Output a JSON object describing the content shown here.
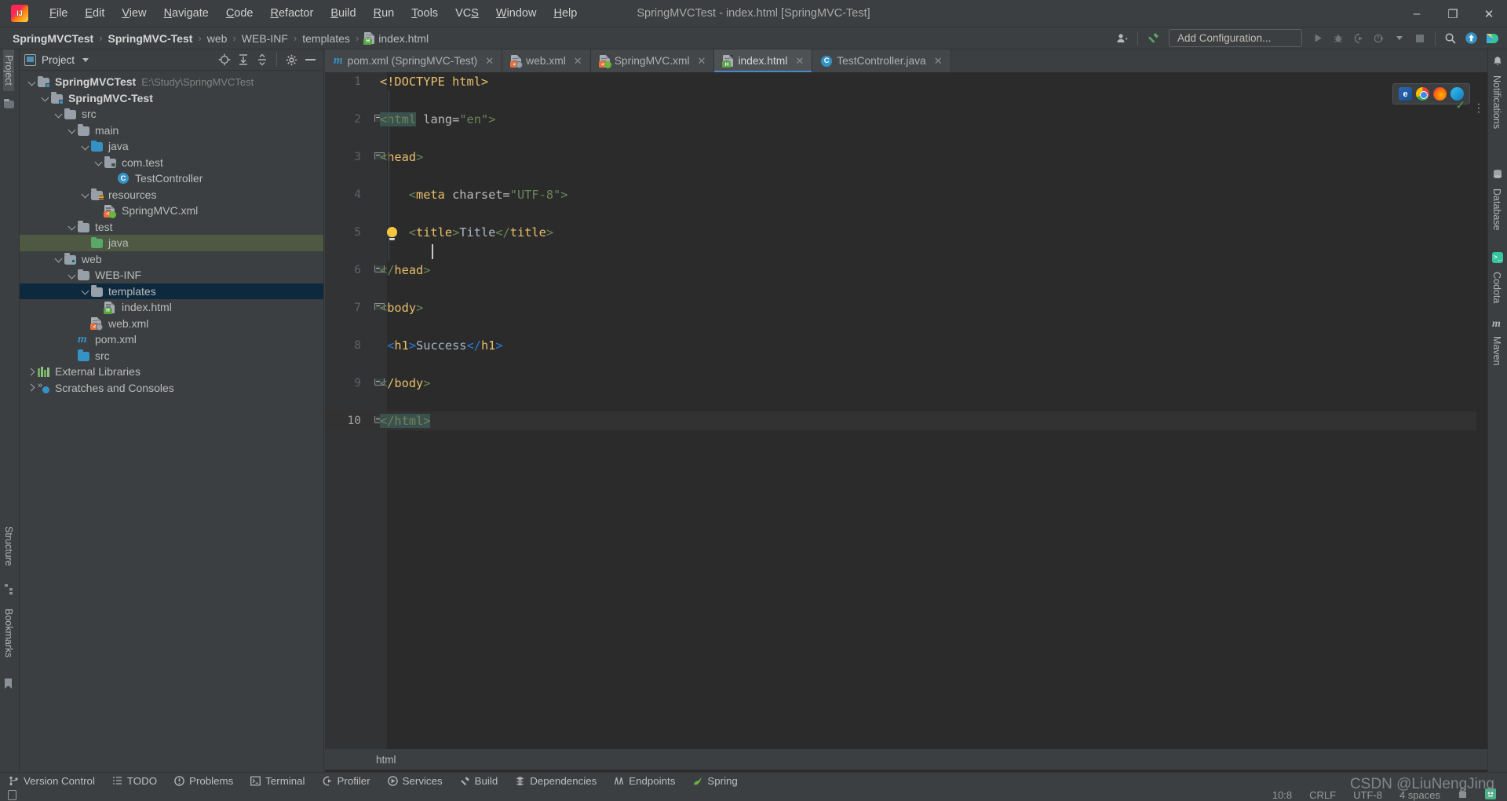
{
  "titlebar": {
    "logo": "intellij-idea-logo",
    "menus": [
      "File",
      "Edit",
      "View",
      "Navigate",
      "Code",
      "Refactor",
      "Build",
      "Run",
      "Tools",
      "VCS",
      "Window",
      "Help"
    ],
    "window_title": "SpringMVCTest - index.html [SpringMVC-Test]",
    "minimize": "–",
    "maximize": "❐",
    "close": "✕"
  },
  "navbar": {
    "breadcrumbs": [
      {
        "label": "SpringMVCTest",
        "bold": true
      },
      {
        "label": "SpringMVC-Test",
        "bold": true
      },
      {
        "label": "web",
        "bold": false
      },
      {
        "label": "WEB-INF",
        "bold": false
      },
      {
        "label": "templates",
        "bold": false
      },
      {
        "label": "index.html",
        "bold": false,
        "icon": "html-file-icon"
      }
    ],
    "separator": "›",
    "add_configuration": "Add Configuration...",
    "icons": [
      "user-avatar-icon",
      "hammer-build-icon",
      "run-icon",
      "debug-icon",
      "run-coverage-icon",
      "profile-icon",
      "stop-icon",
      "search-everywhere-icon",
      "update-project-icon",
      "codota-icon"
    ]
  },
  "left_strip": {
    "tabs": [
      "Project",
      "Structure",
      "Bookmarks"
    ]
  },
  "right_strip": {
    "tabs": [
      "Notifications",
      "Database",
      "Codota",
      "Maven"
    ]
  },
  "project_panel": {
    "title": "Project",
    "header_icons": [
      "locate-icon",
      "expand-all-icon",
      "collapse-all-icon",
      "settings-gear-icon",
      "hide-icon"
    ],
    "tree": [
      {
        "depth": 0,
        "label": "SpringMVCTest",
        "path": "E:\\Study\\SpringMVCTest",
        "arrow": "down",
        "icon": "project-folder-icon",
        "bold": true,
        "state": "none"
      },
      {
        "depth": 1,
        "label": "SpringMVC-Test",
        "path": "",
        "arrow": "down",
        "icon": "module-folder-icon",
        "bold": true,
        "state": "none"
      },
      {
        "depth": 2,
        "label": "src",
        "path": "",
        "arrow": "down",
        "icon": "folder-icon",
        "bold": false,
        "state": "none"
      },
      {
        "depth": 3,
        "label": "main",
        "path": "",
        "arrow": "down",
        "icon": "folder-icon",
        "bold": false,
        "state": "none"
      },
      {
        "depth": 4,
        "label": "java",
        "path": "",
        "arrow": "down",
        "icon": "source-folder-icon",
        "bold": false,
        "state": "none"
      },
      {
        "depth": 5,
        "label": "com.test",
        "path": "",
        "arrow": "down",
        "icon": "package-folder-icon",
        "bold": false,
        "state": "none"
      },
      {
        "depth": 6,
        "label": "TestController",
        "path": "",
        "arrow": "none",
        "icon": "java-class-icon",
        "bold": false,
        "state": "none"
      },
      {
        "depth": 4,
        "label": "resources",
        "path": "",
        "arrow": "down",
        "icon": "resources-folder-icon",
        "bold": false,
        "state": "none"
      },
      {
        "depth": 5,
        "label": "SpringMVC.xml",
        "path": "",
        "arrow": "none",
        "icon": "spring-xml-file-icon",
        "bold": false,
        "state": "none"
      },
      {
        "depth": 3,
        "label": "test",
        "path": "",
        "arrow": "down",
        "icon": "folder-icon",
        "bold": false,
        "state": "none"
      },
      {
        "depth": 4,
        "label": "java",
        "path": "",
        "arrow": "none",
        "icon": "test-source-folder-icon",
        "bold": false,
        "state": "selected-green"
      },
      {
        "depth": 2,
        "label": "web",
        "path": "",
        "arrow": "down",
        "icon": "web-folder-icon",
        "bold": false,
        "state": "none"
      },
      {
        "depth": 3,
        "label": "WEB-INF",
        "path": "",
        "arrow": "down",
        "icon": "folder-icon",
        "bold": false,
        "state": "none"
      },
      {
        "depth": 4,
        "label": "templates",
        "path": "",
        "arrow": "down",
        "icon": "folder-icon",
        "bold": false,
        "state": "selected-blue"
      },
      {
        "depth": 5,
        "label": "index.html",
        "path": "",
        "arrow": "none",
        "icon": "html-file-icon",
        "bold": false,
        "state": "none"
      },
      {
        "depth": 4,
        "label": "web.xml",
        "path": "",
        "arrow": "none",
        "icon": "web-xml-file-icon",
        "bold": false,
        "state": "none"
      },
      {
        "depth": 3,
        "label": "pom.xml",
        "path": "",
        "arrow": "none",
        "icon": "maven-pom-icon",
        "bold": false,
        "state": "none"
      },
      {
        "depth": 3,
        "label": "src",
        "path": "",
        "arrow": "none",
        "icon": "source-folder-icon",
        "bold": false,
        "state": "none"
      },
      {
        "depth": 0,
        "label": "External Libraries",
        "path": "",
        "arrow": "right",
        "icon": "libraries-icon",
        "bold": false,
        "state": "none"
      },
      {
        "depth": 0,
        "label": "Scratches and Consoles",
        "path": "",
        "arrow": "right",
        "icon": "scratches-icon",
        "bold": false,
        "state": "none"
      }
    ]
  },
  "editor": {
    "tabs": [
      {
        "label": "pom.xml (SpringMVC-Test)",
        "icon": "maven-pom-icon",
        "active": false
      },
      {
        "label": "web.xml",
        "icon": "web-xml-file-icon",
        "active": false
      },
      {
        "label": "SpringMVC.xml",
        "icon": "spring-xml-file-icon",
        "active": false
      },
      {
        "label": "index.html",
        "icon": "html-file-icon",
        "active": true
      },
      {
        "label": "TestController.java",
        "icon": "java-class-icon",
        "active": false
      }
    ],
    "close_glyph": "✕",
    "tab_overflow": "⋮",
    "browser_preview": [
      "ie-browser-icon",
      "chrome-browser-icon",
      "firefox-browser-icon",
      "edge-browser-icon"
    ],
    "inspection_status": "✓",
    "lines": [
      {
        "n": 1,
        "indent": 0,
        "fold": "none",
        "segments": [
          {
            "t": "<!DOCTYPE html>",
            "c": "t-doct"
          }
        ]
      },
      {
        "n": 2,
        "indent": 0,
        "fold": "open",
        "segments": [
          {
            "t": "<html",
            "c": "t-punct match-box"
          },
          {
            "t": " ",
            "c": "t-attr"
          },
          {
            "t": "lang",
            "c": "t-attr"
          },
          {
            "t": "=",
            "c": "t-attr"
          },
          {
            "t": "\"en\"",
            "c": "t-str"
          },
          {
            "t": ">",
            "c": "t-punct"
          }
        ]
      },
      {
        "n": 3,
        "indent": 0,
        "fold": "open",
        "segments": [
          {
            "t": "<",
            "c": "t-punct"
          },
          {
            "t": "head",
            "c": "t-tag"
          },
          {
            "t": ">",
            "c": "t-punct"
          }
        ]
      },
      {
        "n": 4,
        "indent": 4,
        "fold": "none",
        "segments": [
          {
            "t": "<",
            "c": "t-punct"
          },
          {
            "t": "meta",
            "c": "t-tag"
          },
          {
            "t": " charset",
            "c": "t-attr"
          },
          {
            "t": "=",
            "c": "t-attr"
          },
          {
            "t": "\"UTF-8\"",
            "c": "t-str"
          },
          {
            "t": ">",
            "c": "t-punct"
          }
        ]
      },
      {
        "n": 5,
        "indent": 4,
        "fold": "none",
        "segments": [
          {
            "t": "<",
            "c": "t-punct"
          },
          {
            "t": "title",
            "c": "t-tag"
          },
          {
            "t": ">",
            "c": "t-punct"
          },
          {
            "t": "Title",
            "c": "t-text"
          },
          {
            "t": "</",
            "c": "t-punct"
          },
          {
            "t": "title",
            "c": "t-tag"
          },
          {
            "t": ">",
            "c": "t-punct"
          }
        ]
      },
      {
        "n": 6,
        "indent": 0,
        "fold": "close",
        "segments": [
          {
            "t": "</",
            "c": "t-punct"
          },
          {
            "t": "head",
            "c": "t-tag"
          },
          {
            "t": ">",
            "c": "t-punct"
          }
        ]
      },
      {
        "n": 7,
        "indent": 0,
        "fold": "open",
        "segments": [
          {
            "t": "<",
            "c": "t-punct"
          },
          {
            "t": "body",
            "c": "t-tag"
          },
          {
            "t": ">",
            "c": "t-punct"
          }
        ]
      },
      {
        "n": 8,
        "indent": 1,
        "fold": "none",
        "segments": [
          {
            "t": "<",
            "c": "t-blue"
          },
          {
            "t": "h1",
            "c": "t-h1"
          },
          {
            "t": ">",
            "c": "t-blue"
          },
          {
            "t": "Success",
            "c": "t-text"
          },
          {
            "t": "</",
            "c": "t-blue"
          },
          {
            "t": "h1",
            "c": "t-h1"
          },
          {
            "t": ">",
            "c": "t-blue"
          }
        ]
      },
      {
        "n": 9,
        "indent": 0,
        "fold": "close",
        "segments": [
          {
            "t": "<",
            "c": "t-punct"
          },
          {
            "t": "/body",
            "c": "t-tag"
          },
          {
            "t": ">",
            "c": "t-punct"
          }
        ]
      },
      {
        "n": 10,
        "indent": 0,
        "fold": "close",
        "segments": [
          {
            "t": "</html>",
            "c": "t-punct match-box"
          }
        ],
        "caret": true
      }
    ],
    "bottom_breadcrumb": "html"
  },
  "bottom_tools": [
    {
      "label": "Version Control",
      "icon": "branch-icon"
    },
    {
      "label": "TODO",
      "icon": "todo-list-icon"
    },
    {
      "label": "Problems",
      "icon": "problems-icon"
    },
    {
      "label": "Terminal",
      "icon": "terminal-icon"
    },
    {
      "label": "Profiler",
      "icon": "profiler-icon"
    },
    {
      "label": "Services",
      "icon": "services-icon"
    },
    {
      "label": "Build",
      "icon": "hammer-build-icon"
    },
    {
      "label": "Dependencies",
      "icon": "dependencies-icon"
    },
    {
      "label": "Endpoints",
      "icon": "endpoints-icon"
    },
    {
      "label": "Spring",
      "icon": "spring-leaf-icon"
    }
  ],
  "statusbar": {
    "position": "10:8",
    "line_separator": "CRLF",
    "encoding": "UTF-8",
    "indent": "4 spaces",
    "read_only_icon": "lock-open-icon",
    "inspection_icon": "inspections-widget-icon"
  },
  "watermark": "CSDN @LiuNengJing",
  "colors": {
    "editor_bg": "#2b2b2b",
    "panel_bg": "#3c3f41",
    "gutter_bg": "#313335",
    "accent_blue": "#3592c4",
    "select_blue": "#0d293e",
    "select_green": "#4e5843",
    "caret_line": "#323232"
  }
}
